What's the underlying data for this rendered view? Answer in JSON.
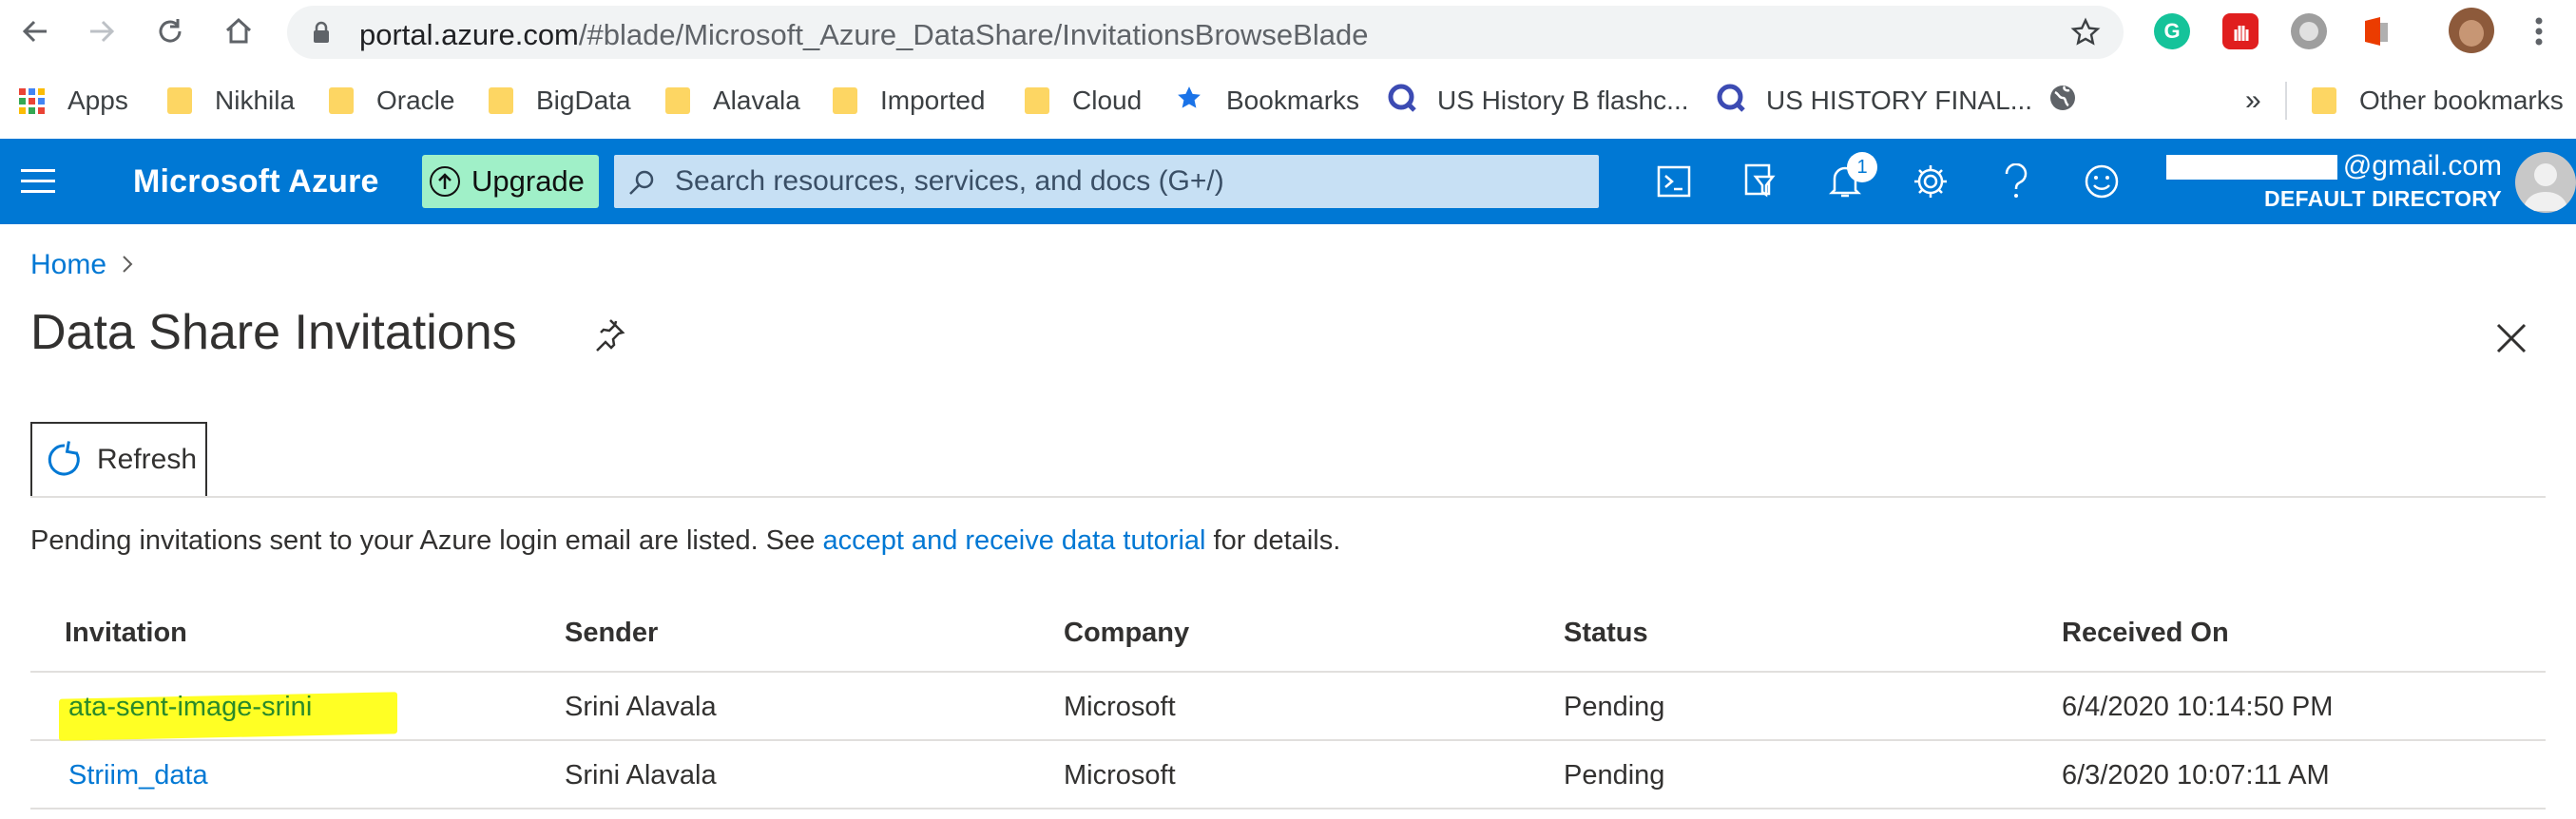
{
  "browser": {
    "url_host": "portal.azure.com",
    "url_path": "/#blade/Microsoft_Azure_DataShare/InvitationsBrowseBlade",
    "bookmarks": [
      {
        "label": "Apps",
        "icon": "apps-grid-icon"
      },
      {
        "label": "Nikhila",
        "icon": "folder-icon"
      },
      {
        "label": "Oracle",
        "icon": "folder-icon"
      },
      {
        "label": "BigData",
        "icon": "folder-icon"
      },
      {
        "label": "Alavala",
        "icon": "folder-icon"
      },
      {
        "label": "Imported",
        "icon": "folder-icon"
      },
      {
        "label": "Cloud",
        "icon": "folder-icon"
      },
      {
        "label": "Bookmarks",
        "icon": "star-icon"
      },
      {
        "label": "US History B flashc...",
        "icon": "quizlet-icon"
      },
      {
        "label": "US HISTORY FINAL...",
        "icon": "quizlet-icon"
      },
      {
        "label": "",
        "icon": "globe-icon"
      }
    ],
    "overflow_label": "»",
    "other_bookmarks": "Other bookmarks"
  },
  "azure": {
    "product_name": "Microsoft Azure",
    "upgrade_label": "Upgrade",
    "search_placeholder": "Search resources, services, and docs (G+/)",
    "notifications_count": "1",
    "account_email_suffix": "@gmail.com",
    "account_directory": "DEFAULT DIRECTORY",
    "brand_color": "#0078d4"
  },
  "page": {
    "breadcrumb_home": "Home",
    "title": "Data Share Invitations",
    "refresh_label": "Refresh",
    "info_prefix": "Pending invitations sent to your Azure login email are listed. See ",
    "info_link": "accept and receive data tutorial",
    "info_suffix": " for details."
  },
  "table": {
    "columns": [
      "Invitation",
      "Sender",
      "Company",
      "Status",
      "Received On"
    ],
    "rows": [
      {
        "invitation": "ata-sent-image-srini",
        "sender": "Srini Alavala",
        "company": "Microsoft",
        "status": "Pending",
        "received": "6/4/2020 10:14:50 PM",
        "highlighted": true
      },
      {
        "invitation": "Striim_data",
        "sender": "Srini Alavala",
        "company": "Microsoft",
        "status": "Pending",
        "received": "6/3/2020 10:07:11 AM",
        "highlighted": false
      }
    ]
  }
}
